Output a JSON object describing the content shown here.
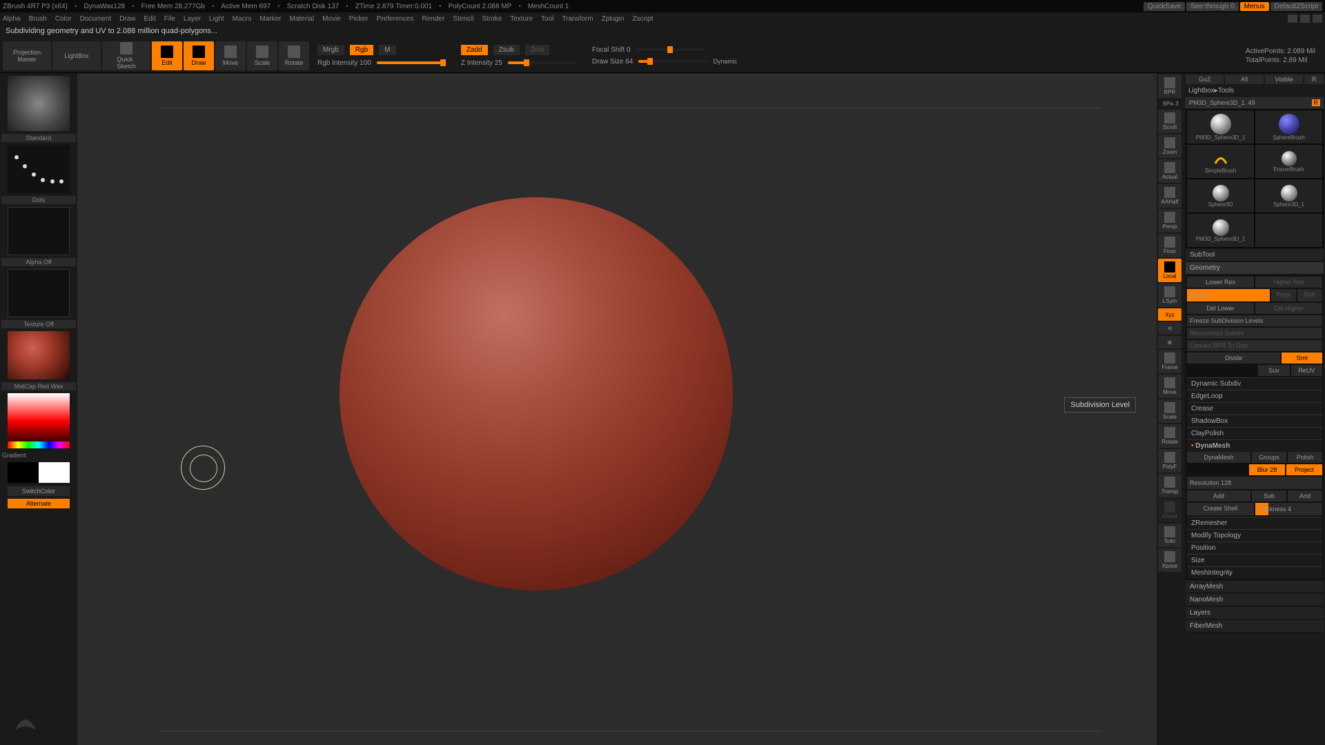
{
  "title_bar": {
    "app": "ZBrush 4R7 P3 (x64)",
    "material": "DynaWax128",
    "free_mem": "Free Mem 28.277Gb",
    "active_mem": "Active Mem 697",
    "scratch": "Scratch Disk 137",
    "ztime": "ZTime 2.879 Timer:0.001",
    "polycount": "PolyCount 2.088 MP",
    "meshcount": "MeshCount 1",
    "quicksave": "QuickSave",
    "seethrough": "See-through  0",
    "menus": "Menus",
    "script": "DefaultZScript"
  },
  "menus": [
    "Alpha",
    "Brush",
    "Color",
    "Document",
    "Draw",
    "Edit",
    "File",
    "Layer",
    "Light",
    "Macro",
    "Marker",
    "Material",
    "Movie",
    "Picker",
    "Preferences",
    "Render",
    "Stencil",
    "Stroke",
    "Texture",
    "Tool",
    "Transform",
    "Zplugin",
    "Zscript"
  ],
  "status": "Subdividing geometry and UV to 2.088 million quad-polygons...",
  "toolbar": {
    "projection": "Projection\nMaster",
    "lightbox": "LightBox",
    "quicksketch": "Quick\nSketch",
    "edit": "Edit",
    "draw": "Draw",
    "move": "Move",
    "scale": "Scale",
    "rotate": "Rotate",
    "mrgb": "Mrgb",
    "rgb": "Rgb",
    "m": "M",
    "rgb_int": "Rgb Intensity 100",
    "zadd": "Zadd",
    "zsub": "Zsub",
    "zcut": "Zcut",
    "z_int": "Z Intensity 25",
    "focal": "Focal Shift 0",
    "draw_size": "Draw Size 64",
    "dynamic": "Dynamic",
    "active_pts": "ActivePoints: 2.089 Mil",
    "total_pts": "TotalPoints: 2.89 Mil"
  },
  "left": {
    "brush": "Standard",
    "stroke": "Dots",
    "alpha": "Alpha Off",
    "texture": "Texture Off",
    "material": "MatCap Red Wax",
    "gradient": "Gradient",
    "switch": "SwitchColor",
    "alternate": "Alternate"
  },
  "tooltip": "Subdivision Level",
  "strip": {
    "bpr": "BPR",
    "spix": "SPix 3",
    "scroll": "Scroll",
    "zoom": "Zoom",
    "actual": "Actual",
    "aahalf": "AAHalf",
    "persp": "Persp",
    "floor": "Floor",
    "local": "Local",
    "lsym": "LSym",
    "xyz": "Xyz",
    "frame": "Frame",
    "move": "Move",
    "scale": "Scale",
    "rotate": "Rotate",
    "polyf": "PolyF",
    "transp": "Transp",
    "ghost": "Ghost",
    "solo": "Solo",
    "xpose": "Xpose"
  },
  "rp": {
    "tabs": {
      "goz": "GoZ",
      "all": "All",
      "visible": "Visible",
      "r": "R"
    },
    "header": "Lightbox▸Tools",
    "tool_name": "PM3D_Sphere3D_1. 49",
    "tools": {
      "t1": "PM3D_Sphere3D_1",
      "t2": "SphereBrush",
      "t3": "SimpleBrush",
      "t4": "ErazerBrush",
      "t5": "Sphere3D",
      "t6": "Sphere3D_1",
      "t7": "PM3D_Sphere3D_1"
    },
    "subtool": "SubTool",
    "geometry": "Geometry",
    "geo": {
      "lower": "Lower Res",
      "higher": "Higher Res",
      "sdiv": "SDiv 8",
      "paqe": "Paqe",
      "rstr": "Rstr",
      "del_lower": "Del Lower",
      "del_higher": "Del Higher",
      "freeze": "Freeze SubDivision Levels",
      "reconstruct": "Reconstruct Subdiv",
      "convert": "Convert BPR To Geo",
      "divide": "Divide",
      "smt": "Smt",
      "suv": "Suv",
      "reuv": "ReUV"
    },
    "sections": {
      "dynsub": "Dynamic Subdiv",
      "edgeloop": "EdgeLoop",
      "crease": "Crease",
      "shadowbox": "ShadowBox",
      "claypolish": "ClayPolish",
      "dynamesh": "DynaMesh"
    },
    "dyna": {
      "btn": "DynaMesh",
      "groups": "Groups",
      "polish": "Polish",
      "blur": "Blur 28",
      "project": "Project",
      "res": "Resolution 128",
      "add": "Add",
      "sub": "Sub",
      "and": "And",
      "shell": "Create Shell",
      "thick": "Thickness 4"
    },
    "sections2": {
      "zrem": "ZRemesher",
      "modtopo": "Modify Topology",
      "pos": "Position",
      "size": "Size",
      "meshint": "MeshIntegrity",
      "array": "ArrayMesh",
      "nano": "NanoMesh",
      "layers": "Layers",
      "fiber": "FiberMesh"
    }
  }
}
